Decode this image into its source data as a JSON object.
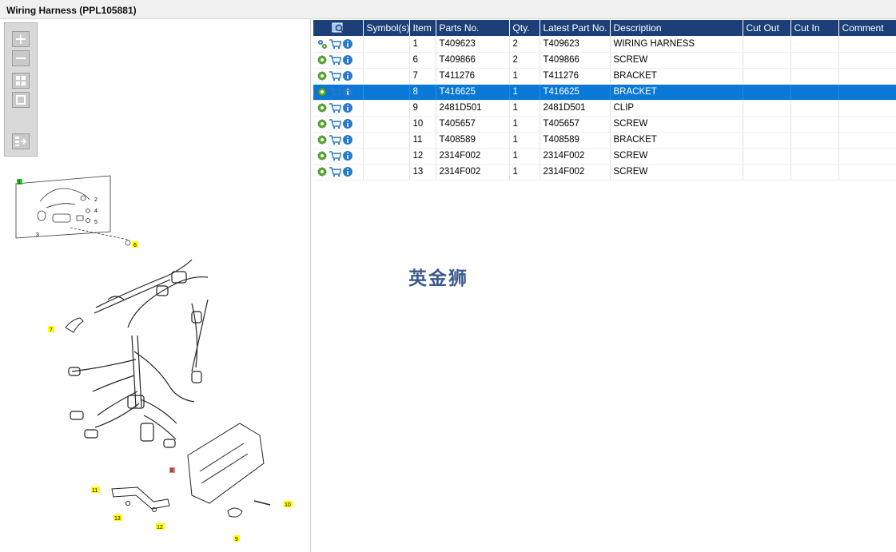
{
  "window": {
    "title": "Wiring Harness (PPL105881)"
  },
  "toolbox": {
    "buttons": [
      "zoom-in",
      "zoom-out",
      "fit-all",
      "fit-page",
      "show-list"
    ]
  },
  "table": {
    "headers": [
      "",
      "Symbol(s)",
      "Item",
      "Parts No.",
      "Qty.",
      "Latest Part No.",
      "Description",
      "Cut Out",
      "Cut In",
      "Comment"
    ],
    "rows": [
      {
        "item": "1",
        "part_no": "T409623",
        "qty": "2",
        "latest_part_no": "T409623",
        "description": "WIRING HARNESS"
      },
      {
        "item": "6",
        "part_no": "T409866",
        "qty": "2",
        "latest_part_no": "T409866",
        "description": "SCREW"
      },
      {
        "item": "7",
        "part_no": "T411276",
        "qty": "1",
        "latest_part_no": "T411276",
        "description": "BRACKET"
      },
      {
        "item": "8",
        "part_no": "T416625",
        "qty": "1",
        "latest_part_no": "T416625",
        "description": "BRACKET"
      },
      {
        "item": "9",
        "part_no": "2481D501",
        "qty": "1",
        "latest_part_no": "2481D501",
        "description": "CLIP"
      },
      {
        "item": "10",
        "part_no": "T405657",
        "qty": "1",
        "latest_part_no": "T405657",
        "description": "SCREW"
      },
      {
        "item": "11",
        "part_no": "T408589",
        "qty": "1",
        "latest_part_no": "T408589",
        "description": "BRACKET"
      },
      {
        "item": "12",
        "part_no": "2314F002",
        "qty": "1",
        "latest_part_no": "2314F002",
        "description": "SCREW"
      },
      {
        "item": "13",
        "part_no": "2314F002",
        "qty": "1",
        "latest_part_no": "2314F002",
        "description": "SCREW"
      }
    ],
    "selected_index": 3
  },
  "watermark": "英金狮",
  "diagram": {
    "callouts": [
      "1",
      "2",
      "3",
      "4",
      "5",
      "6",
      "7",
      "8",
      "9",
      "10",
      "11",
      "12",
      "13"
    ]
  },
  "colors": {
    "header": "#1c3f78",
    "selected": "#0a78d7",
    "callout_yellow": "#ffff00",
    "callout_green": "#22cc22",
    "callout_red": "#e88080"
  }
}
